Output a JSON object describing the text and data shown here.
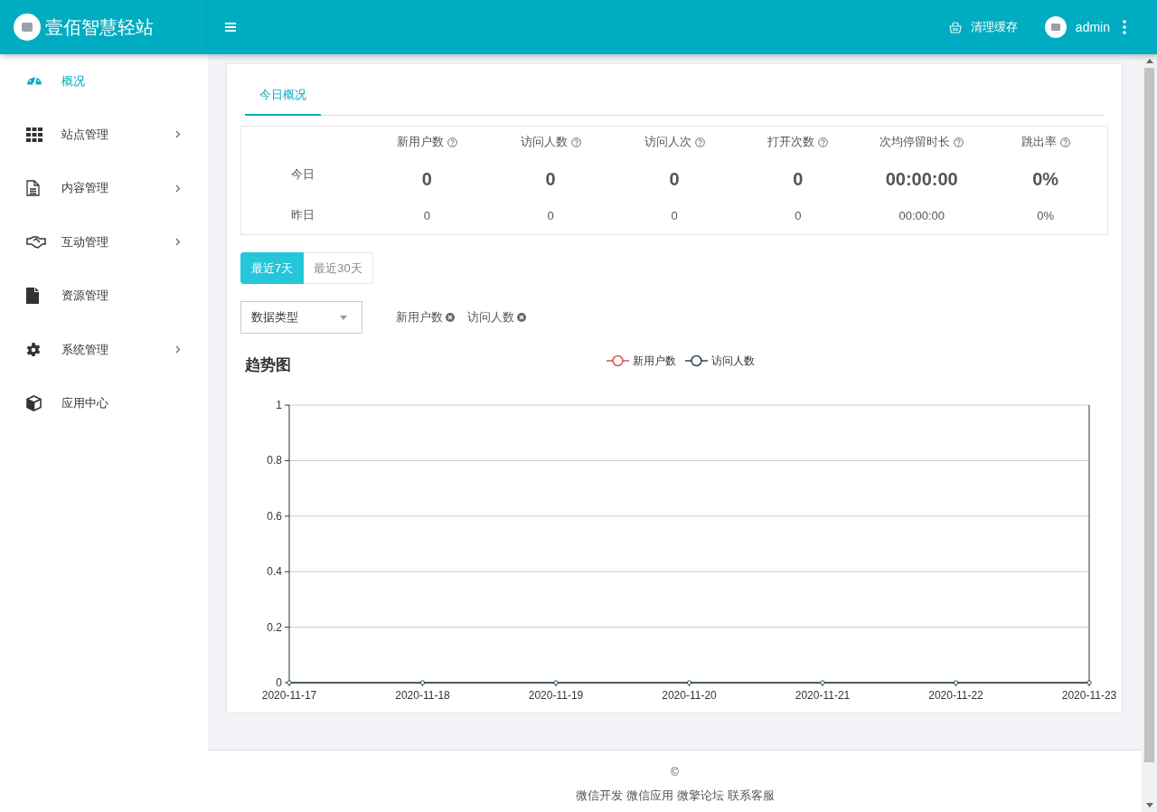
{
  "header": {
    "brand": "壹佰智慧轻站",
    "clear_cache": "清理缓存",
    "user": "admin"
  },
  "sidebar": {
    "items": [
      {
        "label": "概况",
        "selected": true,
        "has_children": false
      },
      {
        "label": "站点管理",
        "selected": false,
        "has_children": true
      },
      {
        "label": "内容管理",
        "selected": false,
        "has_children": true
      },
      {
        "label": "互动管理",
        "selected": false,
        "has_children": true
      },
      {
        "label": "资源管理",
        "selected": false,
        "has_children": false
      },
      {
        "label": "系统管理",
        "selected": false,
        "has_children": true
      },
      {
        "label": "应用中心",
        "selected": false,
        "has_children": false
      }
    ]
  },
  "tabs": [
    {
      "label": "今日概况",
      "selected": true
    }
  ],
  "stats": {
    "row_labels": [
      "今日",
      "昨日"
    ],
    "columns": [
      {
        "label": "新用户数",
        "today": "0",
        "yesterday": "0"
      },
      {
        "label": "访问人数",
        "today": "0",
        "yesterday": "0"
      },
      {
        "label": "访问人次",
        "today": "0",
        "yesterday": "0"
      },
      {
        "label": "打开次数",
        "today": "0",
        "yesterday": "0"
      },
      {
        "label": "次均停留时长",
        "today": "00:00:00",
        "yesterday": "00:00:00"
      },
      {
        "label": "跳出率",
        "today": "0%",
        "yesterday": "0%"
      }
    ]
  },
  "ranges": [
    {
      "label": "最近7天",
      "selected": true
    },
    {
      "label": "最近30天",
      "selected": false
    }
  ],
  "data_type_select": {
    "placeholder": "数据类型"
  },
  "tags": [
    "新用户数",
    "访问人数"
  ],
  "chart": {
    "title": "趋势图",
    "chart_data": {
      "type": "line",
      "categories": [
        "2020-11-17",
        "2020-11-18",
        "2020-11-19",
        "2020-11-20",
        "2020-11-21",
        "2020-11-22",
        "2020-11-23"
      ],
      "series": [
        {
          "name": "新用户数",
          "color": "#d9534f",
          "marker": true,
          "values": [
            null,
            null,
            null,
            null,
            null,
            null,
            null
          ]
        },
        {
          "name": "访问人数",
          "color": "#2f4554",
          "marker": true,
          "values": [
            0,
            0,
            0,
            0,
            0,
            0,
            0
          ]
        }
      ],
      "grid": true,
      "ylim": [
        0,
        1
      ],
      "yticks": [
        0,
        0.2,
        0.4,
        0.6,
        0.8,
        1
      ]
    }
  },
  "footer": {
    "copyright": "©",
    "links": [
      "微信开发",
      "微信应用",
      "微擎论坛",
      "联系客服"
    ]
  }
}
